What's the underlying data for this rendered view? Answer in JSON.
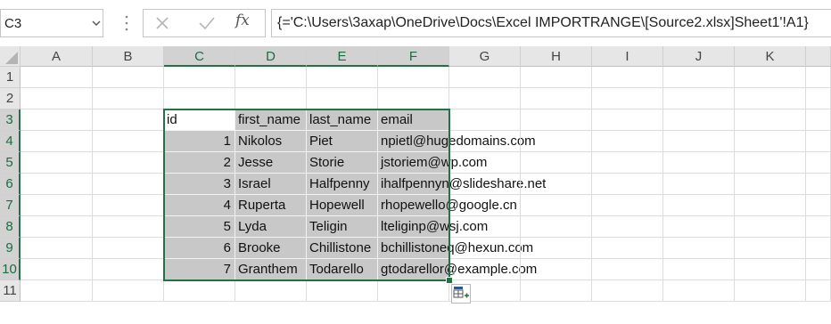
{
  "formula_bar": {
    "name_box": "C3",
    "formula": "{='C:\\Users\\3axap\\OneDrive\\Docs\\Excel IMPORTRANGE\\[Source2.xlsx]Sheet1'!A1}",
    "fx_label": "fx"
  },
  "grid": {
    "columns": [
      "A",
      "B",
      "C",
      "D",
      "E",
      "F",
      "G",
      "H",
      "I",
      "J",
      "K"
    ],
    "rows": [
      "1",
      "2",
      "3",
      "4",
      "5",
      "6",
      "7",
      "8",
      "9",
      "10",
      "11"
    ],
    "table_header": [
      "id",
      "first_name",
      "last_name",
      "email"
    ],
    "table_rows": [
      {
        "id": "1",
        "first_name": "Nikolos",
        "last_name": "Piet",
        "email": "npietl@hugedomains.com"
      },
      {
        "id": "2",
        "first_name": "Jesse",
        "last_name": "Storie",
        "email": "jstoriem@wp.com"
      },
      {
        "id": "3",
        "first_name": "Israel",
        "last_name": "Halfpenny",
        "email": "ihalfpennyn@slideshare.net"
      },
      {
        "id": "4",
        "first_name": "Ruperta",
        "last_name": "Hopewell",
        "email": "rhopewello@google.cn"
      },
      {
        "id": "5",
        "first_name": "Lyda",
        "last_name": "Teligin",
        "email": "lteliginp@wsj.com"
      },
      {
        "id": "6",
        "first_name": "Brooke",
        "last_name": "Chillistone",
        "email": "bchillistoneq@hexun.com"
      },
      {
        "id": "7",
        "first_name": "Granthem",
        "last_name": "Todarello",
        "email": "gtodarellor@example.com"
      }
    ]
  },
  "colors": {
    "accent": "#217346",
    "selected_fill": "#c8c8c8",
    "header_bg": "#e6e6e6"
  }
}
